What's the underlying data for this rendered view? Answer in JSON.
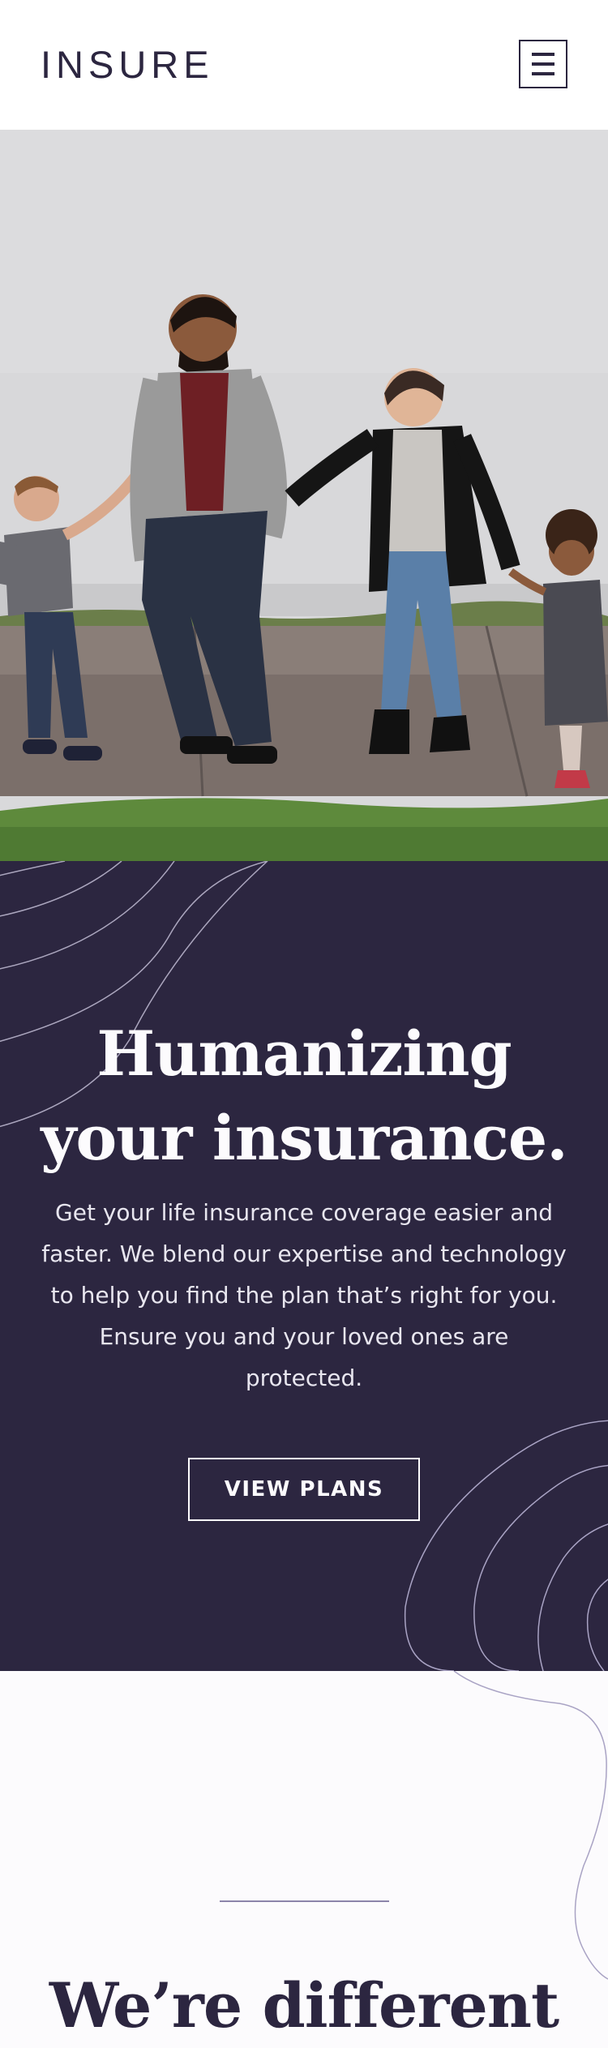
{
  "header": {
    "logo_text": "INSURE",
    "menu_icon": "hamburger-menu-icon"
  },
  "hero": {
    "image_alt": "family-walking-photo",
    "title_line1": "Humanizing",
    "title_line2": "your insurance.",
    "description": "Get your life insurance coverage easier and faster. We blend our expertise and technology to help you find the plan that’s right for you. Ensure you and your loved ones are protected.",
    "cta_label": "VIEW PLANS"
  },
  "difference": {
    "title": "We’re different"
  },
  "colors": {
    "dark_violet": "#2c2640",
    "very_light_gray": "#fcfbfd",
    "grayish_violet": "#8c85aa",
    "white": "#ffffff"
  }
}
